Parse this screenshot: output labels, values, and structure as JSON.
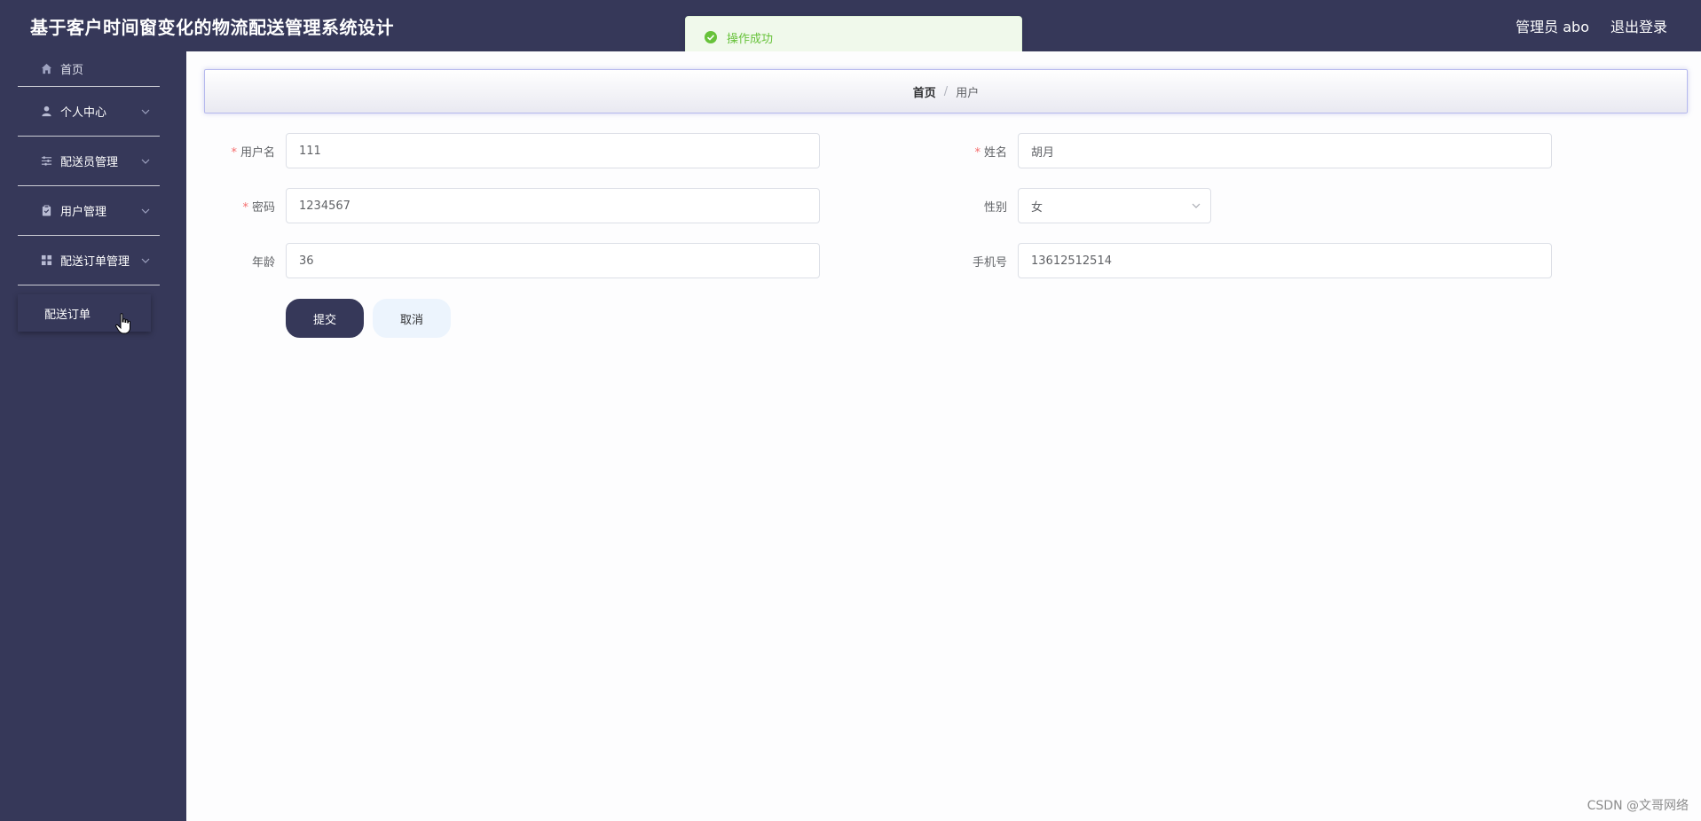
{
  "header": {
    "title": "基于客户时间窗变化的物流配送管理系统设计",
    "user_label": "管理员 abo",
    "logout": "退出登录",
    "bg_color": "#363859"
  },
  "toast": {
    "message": "操作成功",
    "icon": "check-circle-icon",
    "color": "#67c23a"
  },
  "sidebar": {
    "items": [
      {
        "label": "首页",
        "icon": "home-icon"
      },
      {
        "label": "个人中心",
        "icon": "user-icon"
      },
      {
        "label": "配送员管理",
        "icon": "sliders-icon"
      },
      {
        "label": "用户管理",
        "icon": "clipboard-icon"
      },
      {
        "label": "配送订单管理",
        "icon": "grid-icon"
      }
    ],
    "submenu": [
      {
        "label": "配送订单"
      }
    ]
  },
  "breadcrumb": {
    "home": "首页",
    "separator": "/",
    "current": "用户"
  },
  "form": {
    "username": {
      "label": "用户名",
      "value": "111",
      "required": true
    },
    "name": {
      "label": "姓名",
      "value": "胡月",
      "required": true
    },
    "password": {
      "label": "密码",
      "value": "1234567",
      "required": true
    },
    "gender": {
      "label": "性别",
      "value": "女"
    },
    "age": {
      "label": "年龄",
      "value": "36"
    },
    "phone": {
      "label": "手机号",
      "value": "13612512514"
    },
    "required_mark": "*"
  },
  "buttons": {
    "submit": "提交",
    "cancel": "取消"
  },
  "watermark": "CSDN @文哥网络"
}
